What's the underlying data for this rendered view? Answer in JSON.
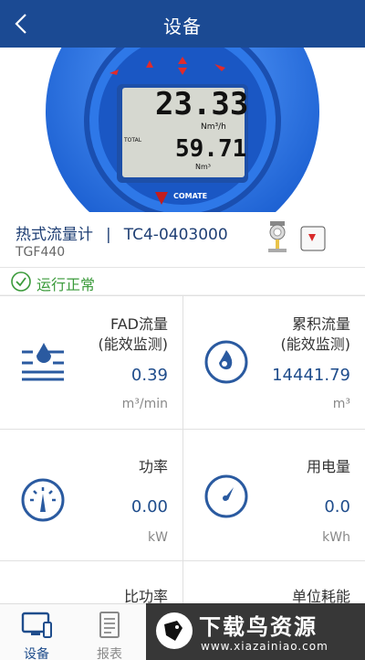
{
  "header": {
    "title": "设备"
  },
  "device_display": {
    "flow_rate": "23.33",
    "flow_unit": "Nm³/h",
    "total_label": "TOTAL",
    "total": "59.71",
    "total_unit": "Nm³",
    "brand": "COMATE"
  },
  "info": {
    "name": "热式流量计",
    "separator": "|",
    "serial": "TC4-0403000",
    "model": "TGF440"
  },
  "status": {
    "text": "运行正常"
  },
  "metrics": [
    {
      "label_line1": "FAD流量",
      "label_line2": "(能效监测)",
      "value": "0.39",
      "unit": "m³/min",
      "icon": "water-flow-icon"
    },
    {
      "label_line1": "累积流量",
      "label_line2": "(能效监测)",
      "value": "14441.79",
      "unit": "m³",
      "icon": "accumulated-flow-icon"
    },
    {
      "label_line1": "功率",
      "value": "0.00",
      "unit": "kW",
      "icon": "power-gauge-icon"
    },
    {
      "label_line1": "用电量",
      "value": "0.0",
      "unit": "kWh",
      "icon": "energy-gauge-icon"
    },
    {
      "label_line1": "比功率"
    },
    {
      "label_line1": "单位耗能"
    }
  ],
  "tabs": [
    {
      "label": "设备",
      "active": true,
      "icon": "monitor-icon"
    },
    {
      "label": "报表",
      "active": false,
      "icon": "report-icon"
    }
  ],
  "watermark": {
    "title": "下载鸟资源",
    "url": "www.xiazainiao.com"
  },
  "colors": {
    "header": "#1b4a93",
    "accent": "#1f4d8c",
    "ok": "#3a9a3a"
  }
}
